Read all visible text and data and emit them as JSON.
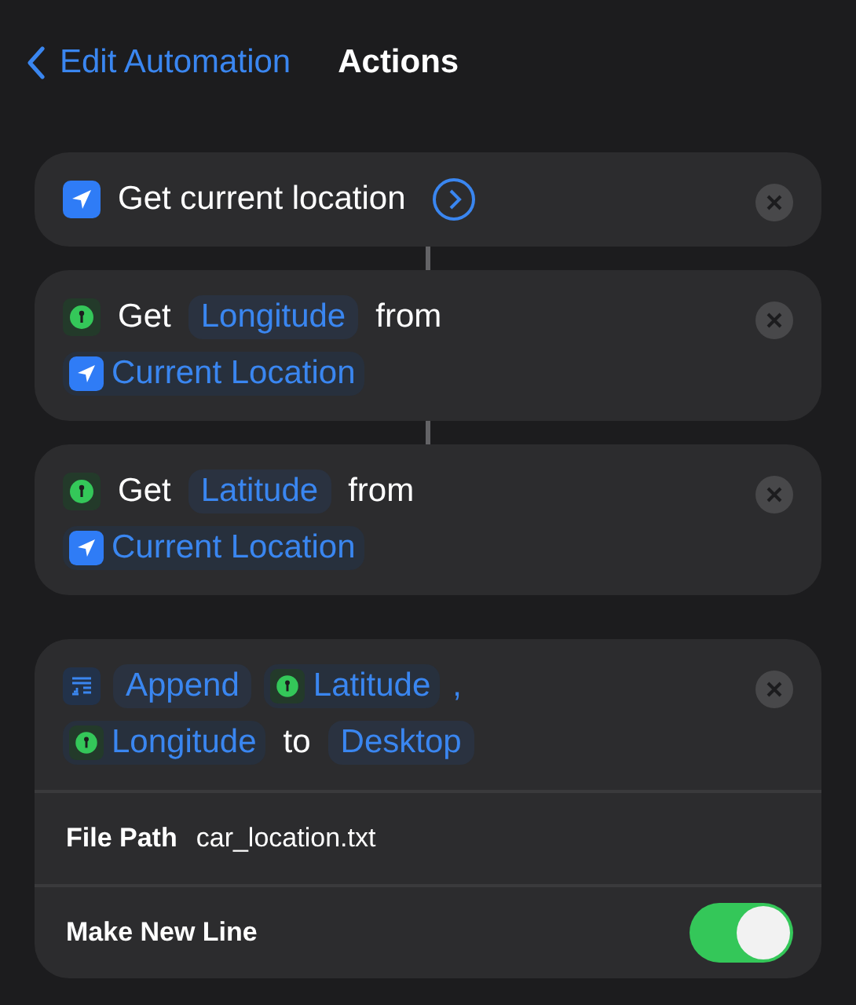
{
  "nav": {
    "back_label": "Edit Automation",
    "title": "Actions"
  },
  "actions": [
    {
      "connected_to_next": true,
      "lines": [
        [
          {
            "kind": "location-icon"
          },
          {
            "kind": "word",
            "text": "Get current location"
          },
          {
            "kind": "details"
          }
        ]
      ]
    },
    {
      "connected_to_next": true,
      "lines": [
        [
          {
            "kind": "coordinate-icon"
          },
          {
            "kind": "word",
            "text": "Get"
          },
          {
            "kind": "param",
            "text": "Longitude"
          },
          {
            "kind": "word",
            "text": "from"
          }
        ],
        [
          {
            "kind": "location-variable",
            "text": "Current Location"
          }
        ]
      ]
    },
    {
      "connected_to_next": false,
      "lines": [
        [
          {
            "kind": "coordinate-icon"
          },
          {
            "kind": "word",
            "text": "Get"
          },
          {
            "kind": "param",
            "text": "Latitude"
          },
          {
            "kind": "word",
            "text": "from"
          }
        ],
        [
          {
            "kind": "location-variable",
            "text": "Current Location"
          }
        ]
      ]
    },
    {
      "lines": [
        [
          {
            "kind": "append-icon"
          },
          {
            "kind": "param",
            "text": "Append"
          },
          {
            "kind": "coordinate-variable",
            "text": "Latitude"
          },
          {
            "kind": "comma",
            "text": ","
          }
        ],
        [
          {
            "kind": "coordinate-variable",
            "text": "Longitude"
          },
          {
            "kind": "word",
            "text": "to"
          },
          {
            "kind": "param",
            "text": "Desktop"
          }
        ]
      ],
      "options": [
        {
          "kind": "text",
          "label": "File Path",
          "value": "car_location.txt"
        },
        {
          "kind": "toggle",
          "label": "Make New Line",
          "on": true
        }
      ]
    }
  ]
}
